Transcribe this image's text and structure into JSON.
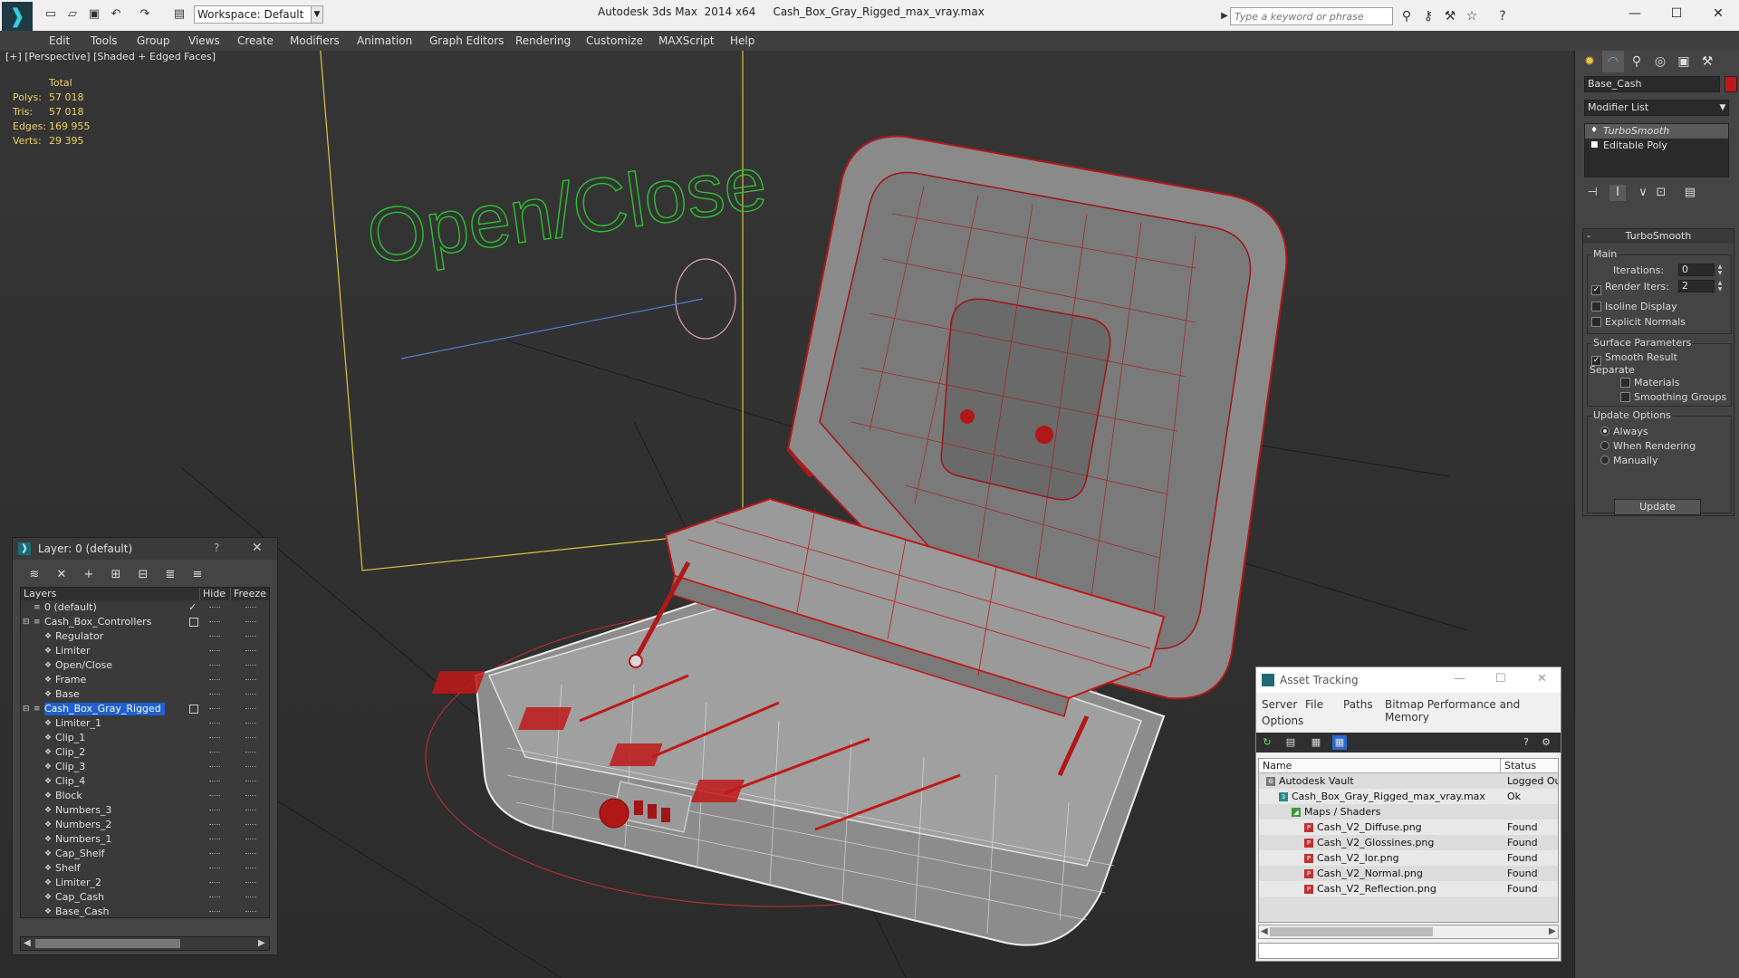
{
  "titlebar": {
    "workspace": "Workspace: Default",
    "app_title": "Autodesk 3ds Max  2014 x64",
    "file_title": "Cash_Box_Gray_Rigged_max_vray.max",
    "search_placeholder": "Type a keyword or phrase"
  },
  "menu": [
    "Edit",
    "Tools",
    "Group",
    "Views",
    "Create",
    "Modifiers",
    "Animation",
    "Graph Editors",
    "Rendering",
    "Customize",
    "MAXScript",
    "Help"
  ],
  "viewport": {
    "label": "[+] [Perspective] [Shaded + Edged Faces]",
    "stats_header": "Total",
    "stats": [
      {
        "label": "Polys:",
        "value": "57 018"
      },
      {
        "label": "Tris:",
        "value": "57 018"
      },
      {
        "label": "Edges:",
        "value": "169 955"
      },
      {
        "label": "Verts:",
        "value": "29 395"
      }
    ],
    "helper_text": "Open/Close"
  },
  "command_panel": {
    "object_name": "Base_Cash",
    "object_color": "#c01818",
    "modifier_list": "Modifier List",
    "stack": [
      "TurboSmooth",
      "Editable Poly"
    ],
    "rollout_title": "TurboSmooth",
    "main_group": "Main",
    "iterations_label": "Iterations:",
    "iterations_value": "0",
    "render_iters_label": "Render Iters:",
    "render_iters_value": "2",
    "isoline": "Isoline Display",
    "explicit_normals": "Explicit Normals",
    "surface_group": "Surface Parameters",
    "smooth_result": "Smooth Result",
    "separate": "Separate",
    "materials": "Materials",
    "smoothing_groups": "Smoothing Groups",
    "update_group": "Update Options",
    "always": "Always",
    "when_rendering": "When Rendering",
    "manually": "Manually",
    "update_button": "Update"
  },
  "layer_explorer": {
    "title": "Layer: 0 (default)",
    "help": "?",
    "col_layers": "Layers",
    "col_hide": "Hide",
    "col_freeze": "Freeze",
    "rows": [
      {
        "label": "0 (default)",
        "level": 0,
        "type": "layer"
      },
      {
        "label": "Cash_Box_Controllers",
        "level": 0,
        "type": "layer"
      },
      {
        "label": "Regulator",
        "level": 1,
        "type": "obj"
      },
      {
        "label": "Limiter",
        "level": 1,
        "type": "obj"
      },
      {
        "label": "Open/Close",
        "level": 1,
        "type": "obj"
      },
      {
        "label": "Frame",
        "level": 1,
        "type": "obj"
      },
      {
        "label": "Base",
        "level": 1,
        "type": "obj"
      },
      {
        "label": "Cash_Box_Gray_Rigged",
        "level": 0,
        "type": "layer"
      },
      {
        "label": "Limiter_1",
        "level": 1,
        "type": "obj"
      },
      {
        "label": "Clip_1",
        "level": 1,
        "type": "obj"
      },
      {
        "label": "Clip_2",
        "level": 1,
        "type": "obj"
      },
      {
        "label": "Clip_3",
        "level": 1,
        "type": "obj"
      },
      {
        "label": "Clip_4",
        "level": 1,
        "type": "obj"
      },
      {
        "label": "Block",
        "level": 1,
        "type": "obj"
      },
      {
        "label": "Numbers_3",
        "level": 1,
        "type": "obj"
      },
      {
        "label": "Numbers_2",
        "level": 1,
        "type": "obj"
      },
      {
        "label": "Numbers_1",
        "level": 1,
        "type": "obj"
      },
      {
        "label": "Cap_Shelf",
        "level": 1,
        "type": "obj"
      },
      {
        "label": "Shelf",
        "level": 1,
        "type": "obj"
      },
      {
        "label": "Limiter_2",
        "level": 1,
        "type": "obj"
      },
      {
        "label": "Cap_Cash",
        "level": 1,
        "type": "obj"
      },
      {
        "label": "Base_Cash",
        "level": 1,
        "type": "obj"
      }
    ]
  },
  "asset_tracking": {
    "title": "Asset Tracking",
    "menu": [
      "Server",
      "File",
      "Paths",
      "Bitmap Performance and Memory",
      "Options"
    ],
    "col_name": "Name",
    "col_status": "Status",
    "rows": [
      {
        "name": "Autodesk Vault",
        "status": "Logged Out",
        "level": 0
      },
      {
        "name": "Cash_Box_Gray_Rigged_max_vray.max",
        "status": "Ok",
        "level": 1
      },
      {
        "name": "Maps / Shaders",
        "status": "",
        "level": 2
      },
      {
        "name": "Cash_V2_Diffuse.png",
        "status": "Found",
        "level": 3
      },
      {
        "name": "Cash_V2_Glossines.png",
        "status": "Found",
        "level": 3
      },
      {
        "name": "Cash_V2_Ior.png",
        "status": "Found",
        "level": 3
      },
      {
        "name": "Cash_V2_Normal.png",
        "status": "Found",
        "level": 3
      },
      {
        "name": "Cash_V2_Reflection.png",
        "status": "Found",
        "level": 3
      }
    ]
  }
}
